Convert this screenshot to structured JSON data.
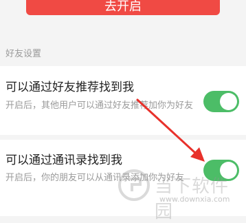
{
  "top_button": {
    "label": "去开启"
  },
  "section": {
    "header": "好友设置"
  },
  "settings": [
    {
      "title": "可以通过好友推荐找到我",
      "desc": "开启后，其他用户可以通过好友推荐加你为好友",
      "enabled": true
    },
    {
      "title": "可以通过通讯录找到我",
      "desc": "开启后，你的朋友可以从通讯录添加你为好友",
      "enabled": true
    }
  ],
  "watermark": {
    "text": "当下软件园",
    "url": "www.downxia.com"
  },
  "colors": {
    "accent": "#f04a44",
    "toggle_on": "#4cbd67",
    "arrow": "#e8312b"
  }
}
